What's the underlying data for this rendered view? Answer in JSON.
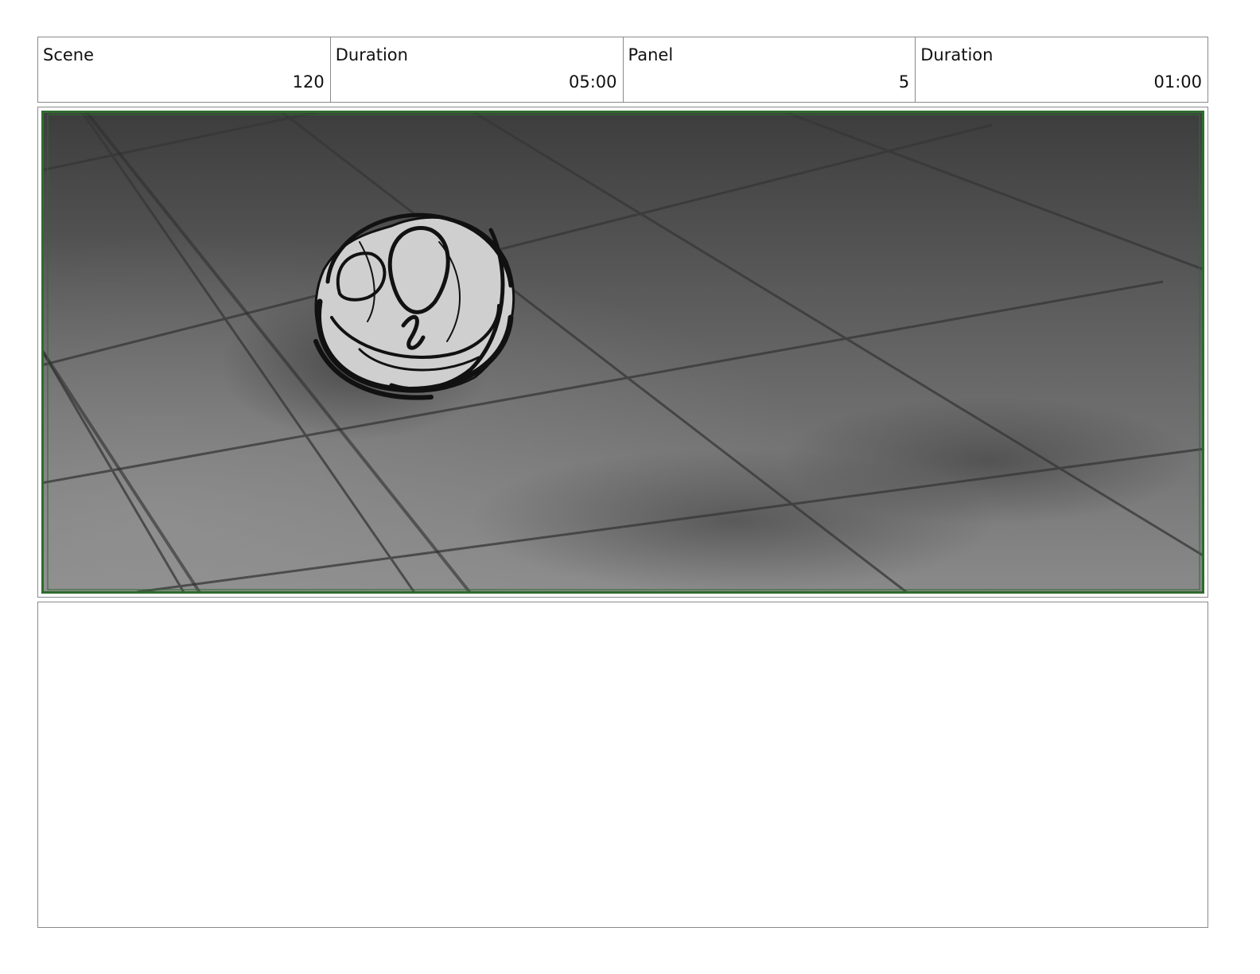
{
  "header": {
    "scene_label": "Scene",
    "scene_value": "120",
    "scene_duration_label": "Duration",
    "scene_duration_value": "05:00",
    "panel_label": "Panel",
    "panel_value": "5",
    "panel_duration_label": "Duration",
    "panel_duration_value": "01:00"
  },
  "colors": {
    "frame_border": "#2f6b2f",
    "floor_dark": "#3c3c3c",
    "floor_light": "#8a8a8a",
    "object_fill": "#cfcfcf",
    "ink": "#111111"
  },
  "icons": {
    "drawing": "scribbled-ball-on-tiled-floor"
  }
}
